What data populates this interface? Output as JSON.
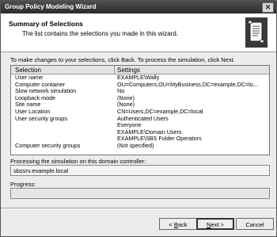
{
  "window": {
    "title": "Group Policy Modeling Wizard",
    "close_glyph": "✕"
  },
  "header": {
    "title": "Summary of Selections",
    "subtitle": "The list contains the selections you made in this wizard.",
    "icon": "scroll-icon"
  },
  "instruction": "To make changes to your selections, click Back. To process the simulation, click Next.",
  "list": {
    "columns": [
      "Selection",
      "Settings"
    ],
    "rows": [
      {
        "selection": "User name",
        "setting": "EXAMPLE\\Wally"
      },
      {
        "selection": "Computer container",
        "setting": "OU=Computers,OU=MyBusiness,DC=example,DC=lo..."
      },
      {
        "selection": "Slow network simulation",
        "setting": "No"
      },
      {
        "selection": "Loopback mode",
        "setting": "(None)"
      },
      {
        "selection": "Site name",
        "setting": "(None)"
      },
      {
        "selection": "User Location",
        "setting": "CN=Users,DC=example,DC=local"
      },
      {
        "selection": "User security groups",
        "setting": "Authenticated Users"
      },
      {
        "selection": "",
        "setting": "Everyone"
      },
      {
        "selection": "",
        "setting": "EXAMPLE\\Domain Users"
      },
      {
        "selection": "",
        "setting": "EXAMPLE\\SBS Folder Operators"
      },
      {
        "selection": "Computer security groups",
        "setting": "(Not specified)"
      }
    ]
  },
  "domain_controller": {
    "label": "Processing the simulation on this domain controller:",
    "value": "sbssrv.example.local"
  },
  "progress": {
    "label": "Progress:",
    "value": 0
  },
  "buttons": {
    "back_prefix": "< ",
    "back_key": "B",
    "back_rest": "ack",
    "next_key": "N",
    "next_rest": "ext >",
    "cancel": "Cancel"
  }
}
